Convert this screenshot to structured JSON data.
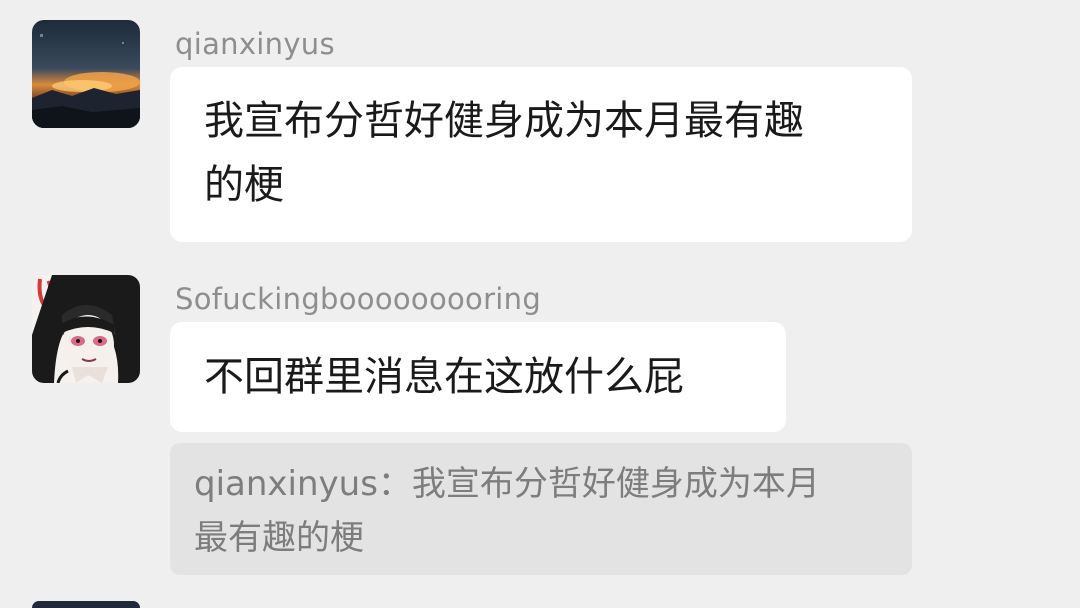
{
  "messages": [
    {
      "sender": "qianxinyus",
      "text_line1": "我宣布分哲好健身成为本月最有趣",
      "text_line2": "的梗"
    },
    {
      "sender": "Sofuckingbooooooooring",
      "text_line1": "不回群里消息在这放什么屁",
      "quote": {
        "line1": "qianxinyus：我宣布分哲好健身成为本月",
        "line2": "最有趣的梗"
      }
    }
  ],
  "colors": {
    "background": "#efefef",
    "bubble": "#ffffff",
    "sender_name": "#8e8e8e",
    "message_text": "#1a1a1a",
    "quote_background": "#e3e3e3",
    "quote_text": "#7d7d7d"
  },
  "icons": {
    "avatar_1": "landscape-photo-avatar",
    "avatar_2": "anime-girl-avatar"
  }
}
